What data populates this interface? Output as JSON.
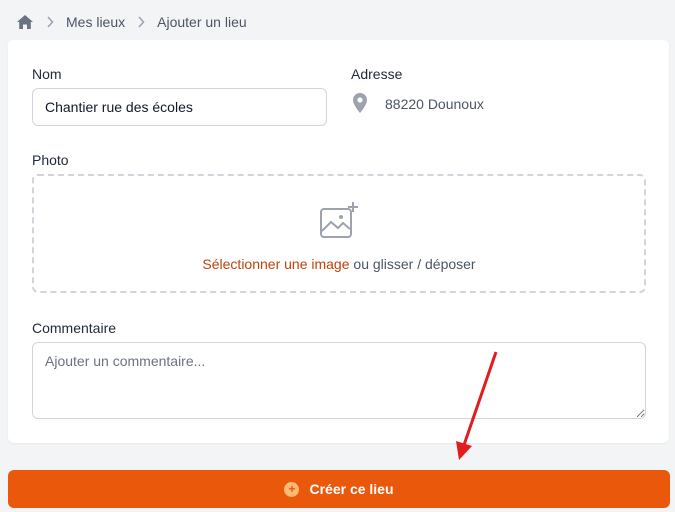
{
  "breadcrumb": {
    "home_icon": "home-icon",
    "items": [
      "Mes lieux",
      "Ajouter un lieu"
    ]
  },
  "form": {
    "name_label": "Nom",
    "name_value": "Chantier rue des écoles",
    "address_label": "Adresse",
    "address_value": "88220 Dounoux",
    "photo_label": "Photo",
    "photo_select": "Sélectionner une image",
    "photo_drop": " ou glisser / déposer",
    "comment_label": "Commentaire",
    "comment_placeholder": "Ajouter un commentaire..."
  },
  "submit": {
    "label": "Créer ce lieu",
    "icon": "plus-circle-icon"
  },
  "colors": {
    "accent": "#ea580c",
    "link": "#c2410c",
    "annotation_arrow": "#e11d1d"
  }
}
